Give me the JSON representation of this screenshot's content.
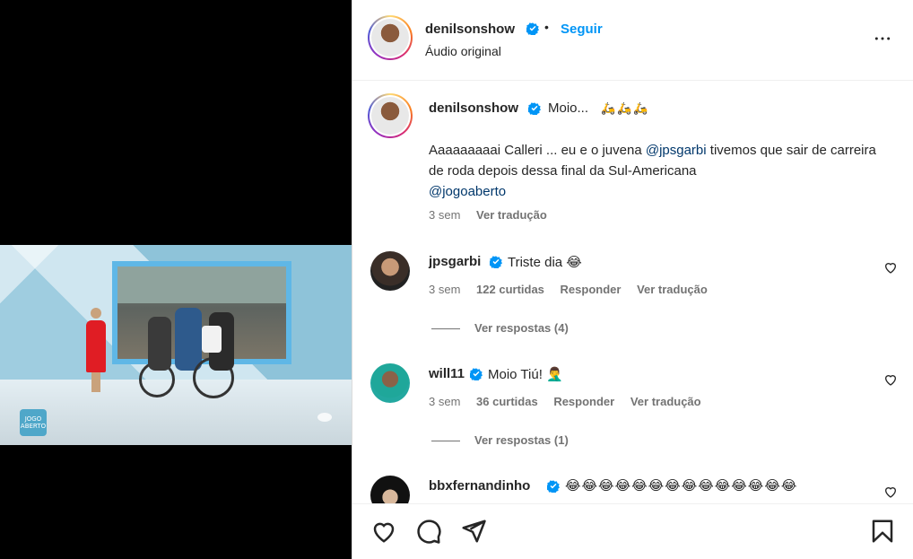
{
  "post": {
    "username": "denilsonshow",
    "follow_label": "Seguir",
    "separator": "•",
    "subtitle": "Áudio original"
  },
  "caption": {
    "username": "denilsonshow",
    "short_text": "Moio...",
    "emoji": "🛵🛵🛵",
    "line1_prefix": "Aaaaaaaaai Calleri ... eu e o juvena ",
    "mention1": "@jpsgarbi",
    "line1_suffix": " tivemos que sair de carreira de roda depois dessa final da Sul-Americana",
    "mention2": "@jogoaberto",
    "time": "3 sem",
    "translate": "Ver tradução"
  },
  "comments": [
    {
      "username": "jpsgarbi",
      "text": "Triste dia 😂",
      "time": "3 sem",
      "likes": "122 curtidas",
      "reply": "Responder",
      "translate": "Ver tradução",
      "replies": "Ver respostas (4)"
    },
    {
      "username": "will11",
      "text": "Moio Tiú! 🤦‍♂️",
      "time": "3 sem",
      "likes": "36 curtidas",
      "reply": "Responder",
      "translate": "Ver tradução",
      "replies": "Ver respostas (1)"
    },
    {
      "username": "bbxfernandinho",
      "text": "😂😂😂😂😂😂😂😂😂😂😂😂😂😂"
    }
  ],
  "video": {
    "logo_text": "JOGO ABERTO"
  },
  "icons": {
    "verified": "verified-badge-icon",
    "more": "more-options-icon",
    "heart": "heart-icon",
    "comment": "comment-icon",
    "share": "share-icon",
    "save": "bookmark-icon"
  },
  "colors": {
    "accent": "#0095f6",
    "mention": "#00376b",
    "muted": "#737373"
  }
}
